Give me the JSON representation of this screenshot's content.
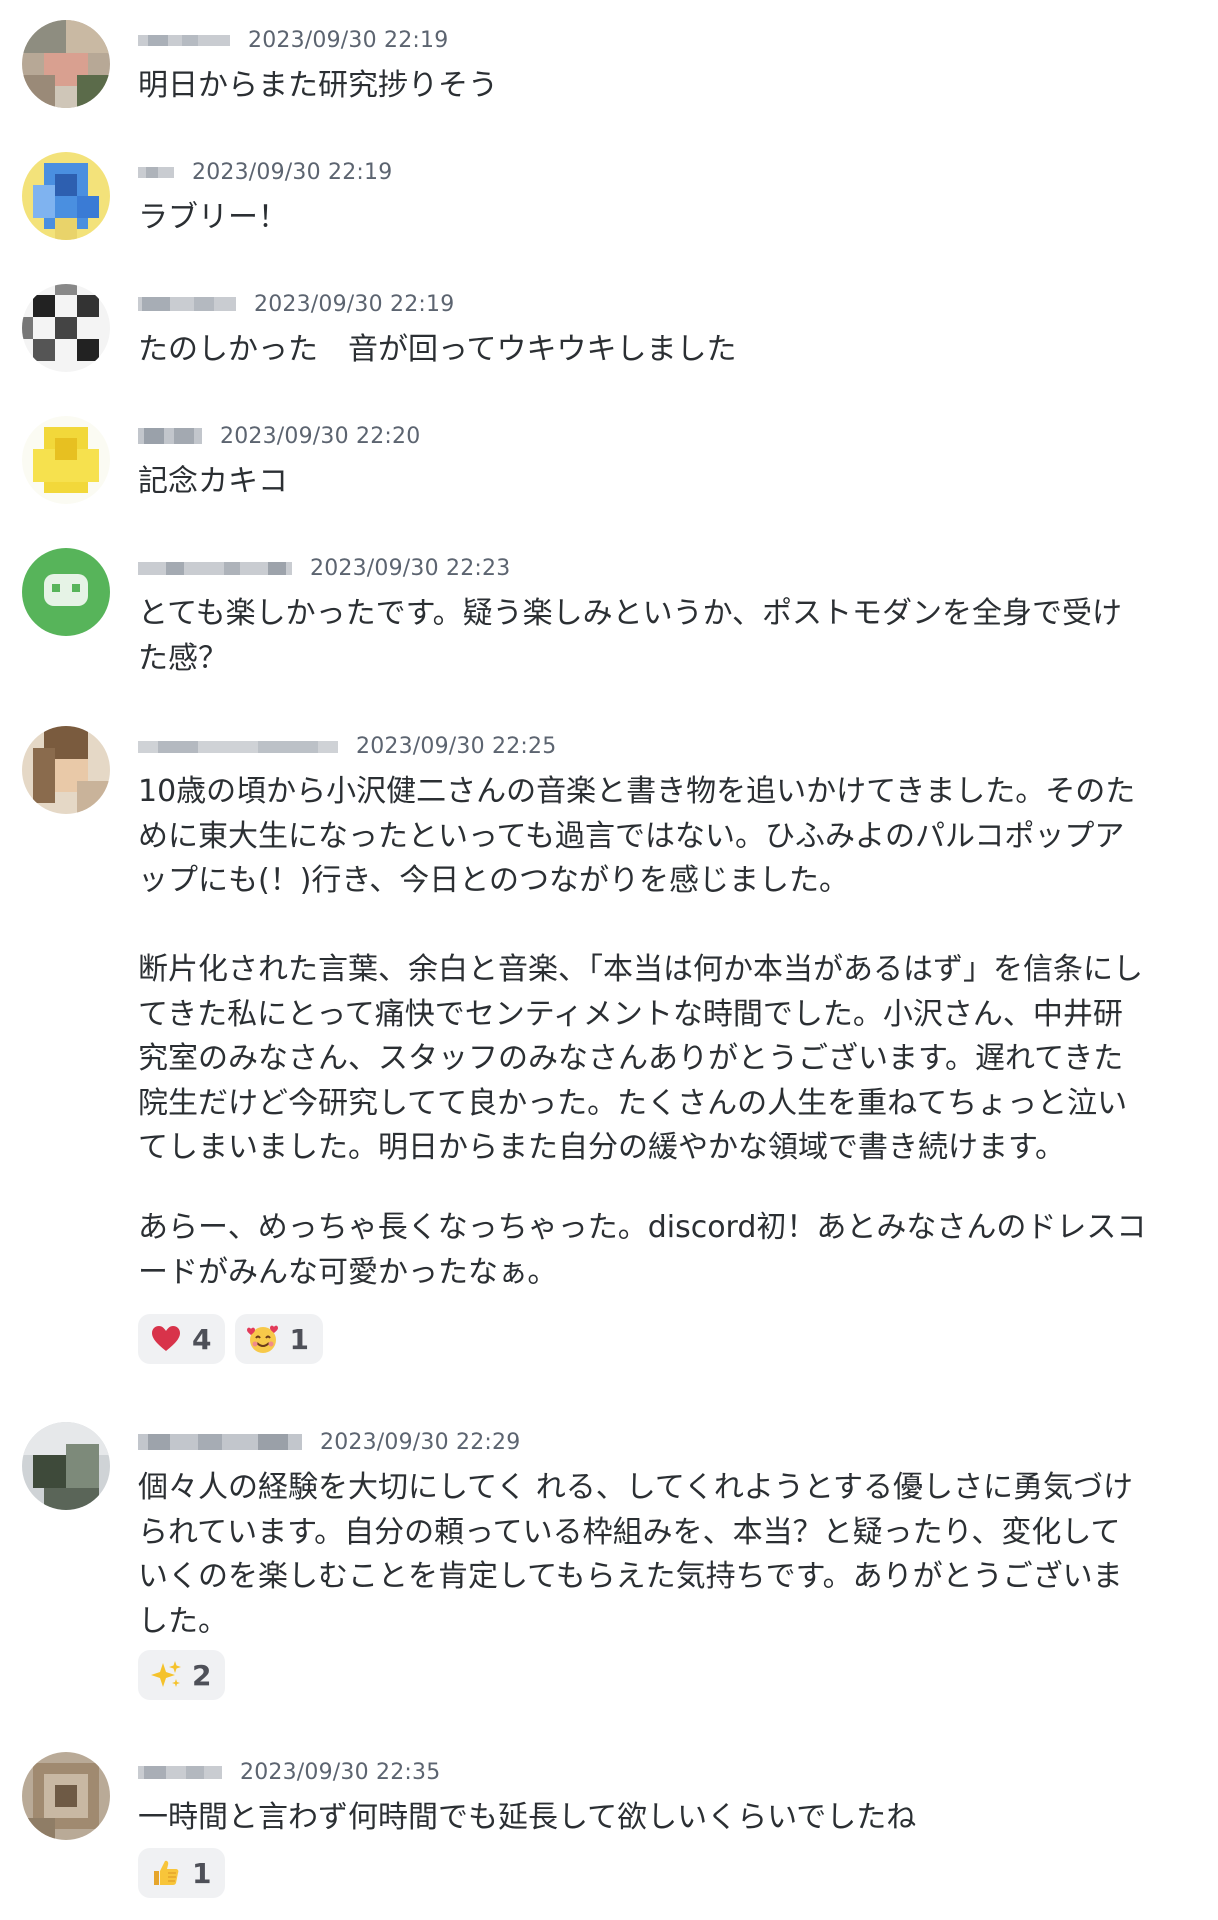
{
  "messages": [
    {
      "time": "2023/09/30 22:19",
      "text": "明日からまた研究捗りそう",
      "reactions": []
    },
    {
      "time": "2023/09/30 22:19",
      "text": "ラブリー！",
      "reactions": []
    },
    {
      "time": "2023/09/30 22:19",
      "text": "たのしかった　音が回ってウキウキしました",
      "reactions": []
    },
    {
      "time": "2023/09/30 22:20",
      "text": "記念カキコ",
      "reactions": []
    },
    {
      "time": "2023/09/30 22:23",
      "text": "とても楽しかったです。疑う楽しみというか、ポストモダンを全身で受けた感？",
      "reactions": []
    },
    {
      "time": "2023/09/30 22:25",
      "text": "10歳の頃から小沢健二さんの音楽と書き物を追いかけてきました。そのために東大生になったといっても過言ではない。ひふみよのパルコポップアップにも(！)行き、今日とのつながりを感じました。\n\n断片化された言葉、余白と音楽、「本当は何か本当があるはず」を信条にしてきた私にとって痛快でセンティメントな時間でした。小沢さん、中井研究室のみなさん、スタッフのみなさんありがとうございます。遅れてきた院生だけど今研究してて良かった。たくさんの人生を重ねてちょっと泣いてしまいました。明日からまた自分の緩やかな領域で書き続けます。",
      "text2": "あらー、めっちゃ長くなっちゃった。discord初！あとみなさんのドレスコードがみんな可愛かったなぁ。",
      "reactions": [
        {
          "emoji": "heart-emoji",
          "count": "4"
        },
        {
          "emoji": "smiling-hearts-emoji",
          "count": "1"
        }
      ]
    },
    {
      "time": "2023/09/30 22:29",
      "text": "個々人の経験を大切にしてく れる、してくれようとする優しさに勇気づけられています。自分の頼っている枠組みを、本当？と疑ったり、変化していくのを楽しむことを肯定してもらえた気持ちです。ありがとうございました。",
      "reactions": [
        {
          "emoji": "sparkles-emoji",
          "count": "2"
        }
      ]
    },
    {
      "time": "2023/09/30 22:35",
      "text": "一時間と言わず何時間でも延長して欲しいくらいでしたね",
      "reactions": [
        {
          "emoji": "thumbs-up-emoji",
          "count": "1"
        }
      ]
    }
  ]
}
